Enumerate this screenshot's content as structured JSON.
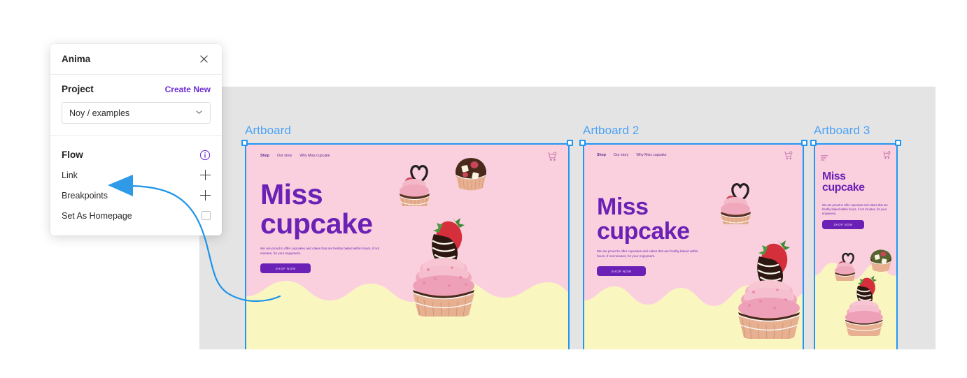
{
  "panel": {
    "title": "Anima",
    "close_icon": "close-icon",
    "project": {
      "label": "Project",
      "create_new": "Create New",
      "select_value": "Noy / examples",
      "chevron_icon": "chevron-down-icon"
    },
    "flow": {
      "label": "Flow",
      "info_icon": "info-icon",
      "rows": [
        {
          "label": "Link",
          "control": "plus-icon"
        },
        {
          "label": "Breakpoints",
          "control": "plus-icon"
        },
        {
          "label": "Set As Homepage",
          "control": "checkbox"
        }
      ]
    }
  },
  "annotation": {
    "arrow_icon": "arrow-left-icon",
    "color": "#1d93e8",
    "points_at": "Breakpoints"
  },
  "canvas": {
    "background_color": "#e4e4e4",
    "selection_color": "#2196f3"
  },
  "artboards": [
    {
      "label": "Artboard",
      "nav": [
        "Shop",
        "Our story",
        "Why Miss cupcake"
      ],
      "cart_icon": "shopping-cart-icon",
      "heading_line1": "Miss",
      "heading_line2": "cupcake",
      "body": "We are proud to offer cupcakes and cakes that are freshly baked within hours, if not minutes, for your enjoyment.",
      "cta": "SHOP NOW",
      "bg_color": "#fbd0de",
      "wave_color": "#faf6c0",
      "heading_color": "#6b21b5"
    },
    {
      "label": "Artboard 2",
      "nav": [
        "Shop",
        "Our story",
        "Why Miss cupcake"
      ],
      "cart_icon": "shopping-cart-icon",
      "heading_line1": "Miss",
      "heading_line2": "cupcake",
      "body": "We are proud to offer cupcakes and cakes that are freshly baked within hours, if not minutes, for your enjoyment.",
      "cta": "SHOP NOW",
      "bg_color": "#fbd0de",
      "wave_color": "#faf6c0",
      "heading_color": "#6b21b5"
    },
    {
      "label": "Artboard 3",
      "menu_icon": "hamburger-menu-icon",
      "cart_icon": "shopping-cart-icon",
      "heading_line1": "Miss",
      "heading_line2": "cupcake",
      "body": "We are proud to offer cupcakes and cakes that are freshly baked within hours, if not minutes, for your enjoyment.",
      "cta": "SHOP NOW",
      "bg_color": "#fbd0de",
      "wave_color": "#faf6c0",
      "heading_color": "#6b21b5"
    }
  ]
}
